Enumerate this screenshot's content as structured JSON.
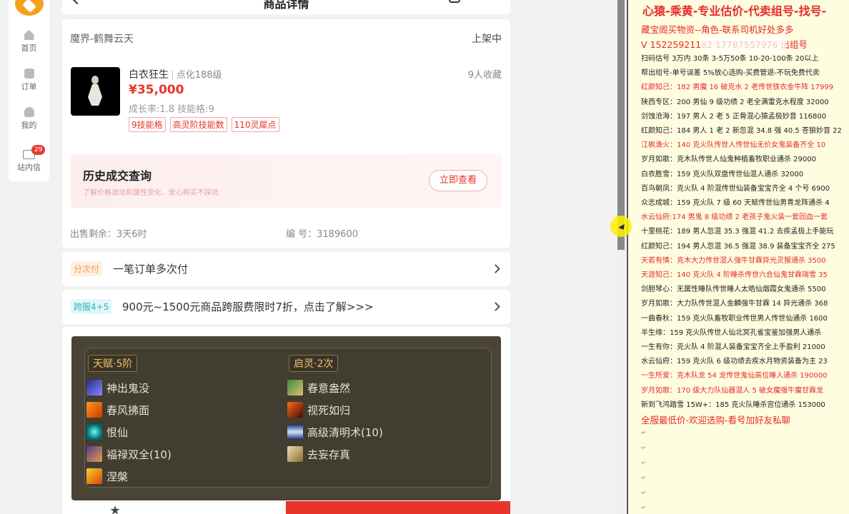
{
  "nav": {
    "items": [
      {
        "label": "首页",
        "icon": "home-icon"
      },
      {
        "label": "订单",
        "icon": "order-icon"
      },
      {
        "label": "我的",
        "icon": "user-icon"
      },
      {
        "label": "站内信",
        "icon": "mail-icon",
        "badge": "29"
      }
    ]
  },
  "header": {
    "title": "商品详情"
  },
  "product": {
    "server": "魔界-鹤舞云天",
    "status": "上架中",
    "role_name": "白衣狂生",
    "role_level": "点化188级",
    "favorites": "9人收藏",
    "price": "¥35,000",
    "rates": "成长率:1.8 技能格:9",
    "tags": [
      "9技能格",
      "高灵阶技能数",
      "110灵犀点"
    ]
  },
  "history": {
    "title": "历史成交查询",
    "subtitle": "了解价格波动和属性变化，安心购买不踩坑",
    "button": "立即查看"
  },
  "sale": {
    "remaining": "出售剩余：3天6时",
    "serial": "编 号：3189600"
  },
  "rows": [
    {
      "tag": "分次付",
      "text": "一笔订单多次付"
    },
    {
      "tag": "跨服4+5",
      "text": "900元~1500元商品跨服费限时7折，点击了解>>>"
    }
  ],
  "skills": {
    "talent_head": "天赋·5阶",
    "qiling_head": "启灵·2次",
    "left": [
      "神出鬼没",
      "春风拂面",
      "恨仙",
      "福禄双全(10)",
      "涅槃"
    ],
    "right": [
      "春意盎然",
      "视死如归",
      "高级清明术(10)",
      "去妄存真"
    ]
  },
  "doc": {
    "title": "心猿-乘黄-专业估价-代卖组号-找号-",
    "lines": [
      {
        "t": "藏宝阁买物资--角色-联系司机好处多多",
        "c": "red",
        "big": true
      },
      {
        "t": "V 15225921182  17787557976   出组号",
        "c": "red",
        "big": true
      },
      {
        "t": "扫码估号 3万内 30条 3-5万50条 10-20-100条 20以上",
        "c": "black"
      },
      {
        "t": "帮出组号-单号误差 5%放心选购-买费管退-不玩免费代卖",
        "c": "black"
      },
      {
        "t": "红颜知己：182 男魔 16 破克水 2 老传世铁衣金牛阵 17999",
        "c": "red"
      },
      {
        "t": "陕西专区：200 男仙 9 级功绩 2 老全满雷克水程度 32000",
        "c": "black"
      },
      {
        "t": "剑蚀沧海：197 男人 2 老 5 正骨混心猿孟极妙音 116800",
        "c": "black"
      },
      {
        "t": "红颜知己：184 男人 1 老 2 新忽混 34.8 强 40.5 苍狼妙音 22",
        "c": "black"
      },
      {
        "t": "江枫渔火：140 克火队传世人传世仙无价女鬼装备齐全 10",
        "c": "red"
      },
      {
        "t": "岁月如歌：克木队传世人仙鬼种植畜牧职业通杀 29000",
        "c": "black"
      },
      {
        "t": "白衣胜雪：159 克火队双盘传世仙混人通杀 32000",
        "c": "black"
      },
      {
        "t": "百鸟朝凤：克火队 4 阶混传世仙装备宝宝齐全 4 个号 6900",
        "c": "black"
      },
      {
        "t": "众志成城：159 克火队 7 级 60 天赋传世仙男青龙阵通杀 4",
        "c": "black"
      },
      {
        "t": "水云仙府:174 男鬼 8 级功绩 2 老孩子鬼火装一套回血一套",
        "c": "red"
      },
      {
        "t": "十里桃花：189 男人忽混 35.3 强混 41.2 去疾孟极上手能玩",
        "c": "black"
      },
      {
        "t": "红颜知己：194 男人忽混 36.5 强混 38.9 装备宝宝齐全 275",
        "c": "black"
      },
      {
        "t": "天若有情：克木大力传世混人强牛甘霖异光灵猴通杀 3500",
        "c": "red"
      },
      {
        "t": "天涯知己：140 克火队 4 阶睡杀传世六合仙鬼甘霖瑞雪 35",
        "c": "red"
      },
      {
        "t": "剑胆琴心：无属性睡队传世睡人太皓仙烟霞女鬼通杀 5500",
        "c": "black"
      },
      {
        "t": "岁月如歌：大力队传世混人金麟强牛甘霖 14 异光通杀 368",
        "c": "black"
      },
      {
        "t": "一曲春秋：159 克火队畜牧职业传世男人传世仙通杀 1600",
        "c": "black"
      },
      {
        "t": "半生缘：159 克火队传世人仙北冥孔雀宝鉴加强男人通杀",
        "c": "black"
      },
      {
        "t": "一生有你：克火队 4 阶混人装备宝宝齐全上手盈利 21000",
        "c": "black"
      },
      {
        "t": "水云仙府：159 克火队 6 级功绩去疾水月物资装备为主 23",
        "c": "black"
      },
      {
        "t": "一生所爱：克木队龙 54 龙传世鬼仙高位睡人通杀 190000",
        "c": "red"
      },
      {
        "t": "岁月如歌：170 级大力队仙器混人 5 破女魔强牛魔甘霖龙",
        "c": "red"
      },
      {
        "t": "新到飞鸿踏雪 15W+：185 克火队睡杀宫位通杀 153000",
        "c": "black"
      },
      {
        "t": "全服最低价-欢迎选购-看号加好友私聊",
        "c": "red",
        "big": true
      }
    ]
  },
  "colors": {
    "accent": "#e8342a",
    "doc_bg": "#fffde0",
    "skills_bg": "#4a4436"
  }
}
